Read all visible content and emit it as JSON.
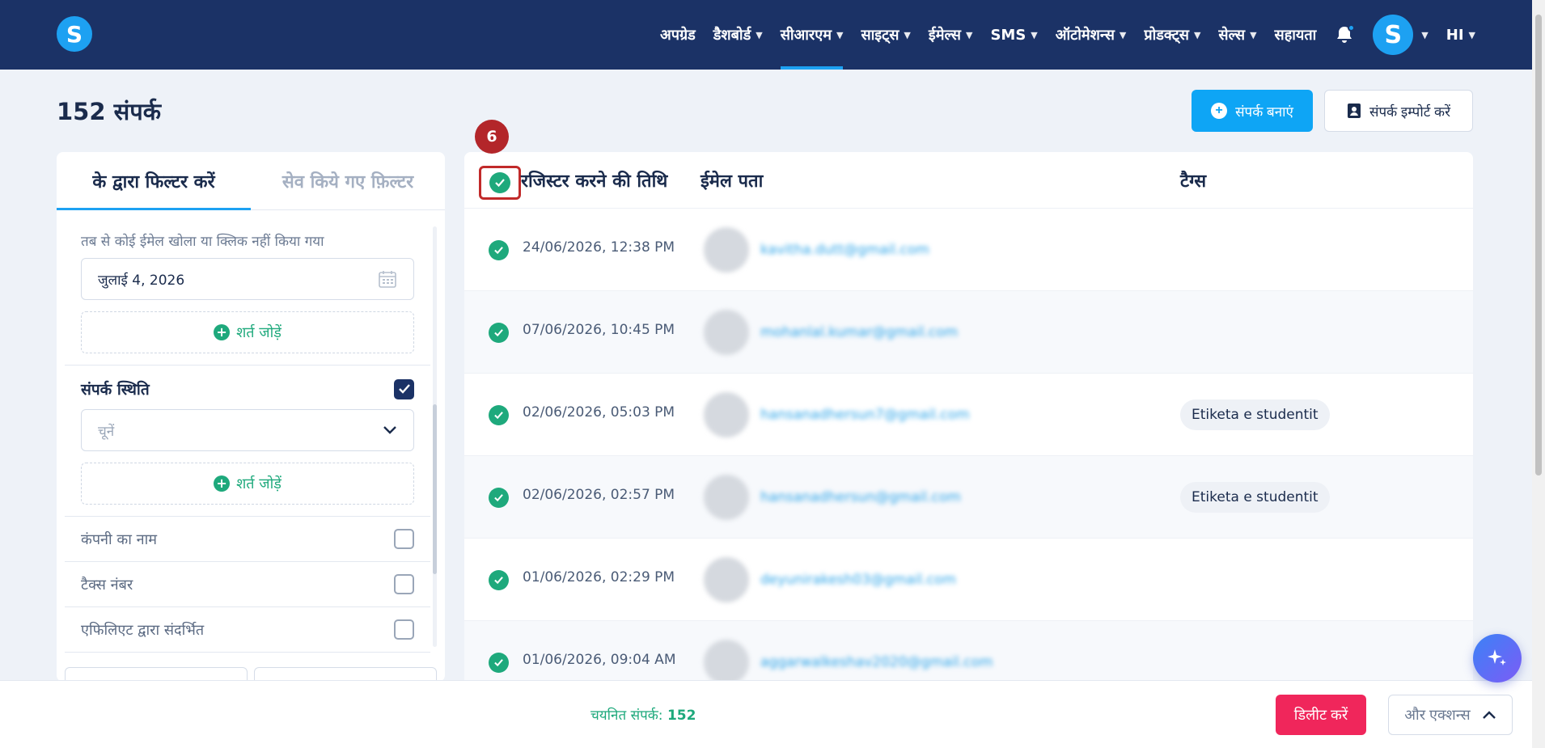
{
  "nav": {
    "items": [
      {
        "label": "अपग्रेड",
        "chevron": false
      },
      {
        "label": "डैशबोर्ड",
        "chevron": true
      },
      {
        "label": "सीआरएम",
        "chevron": true,
        "active": true
      },
      {
        "label": "साइट्स",
        "chevron": true
      },
      {
        "label": "ईमेल्स",
        "chevron": true
      },
      {
        "label": "SMS",
        "chevron": true
      },
      {
        "label": "ऑटोमेशन्स",
        "chevron": true
      },
      {
        "label": "प्रोडक्ट्स",
        "chevron": true
      },
      {
        "label": "सेल्स",
        "chevron": true
      },
      {
        "label": "सहायता",
        "chevron": false
      }
    ],
    "avatar_letter": "S",
    "language": "HI"
  },
  "logo_letter": "S",
  "page": {
    "title": "152 संपर्क",
    "create_button": "संपर्क बनाएं",
    "import_button": "संपर्क इम्पोर्ट करें"
  },
  "filters": {
    "tab_filter_by": "के द्वारा फिल्टर करें",
    "tab_saved": "सेव किये गए फ़िल्टर",
    "hint": "तब से कोई ईमेल खोला या क्लिक नहीं किया गया",
    "date_value": "जुलाई 4, 2026",
    "add_condition": "शर्त जोड़ें",
    "contact_status_label": "संपर्क स्थिति",
    "select_placeholder": "चूनें",
    "checkbox_rows": [
      "कंपनी का नाम",
      "टैक्स नंबर",
      "एफिलिएट द्वारा संदर्भित"
    ]
  },
  "table": {
    "col_date": "रजिस्टर करने की तिथि",
    "col_email": "ईमेल पता",
    "col_tags": "टैग्स",
    "rows": [
      {
        "date": "24/06/2026, 12:38 PM",
        "email": "kavitha.dutt@gmail.com",
        "tag": ""
      },
      {
        "date": "07/06/2026, 10:45 PM",
        "email": "mohanlal.kumar@gmail.com",
        "tag": ""
      },
      {
        "date": "02/06/2026, 05:03 PM",
        "email": "hansanadhersun7@gmail.com",
        "tag": "Etiketa e studentit"
      },
      {
        "date": "02/06/2026, 02:57 PM",
        "email": "hansanadhersun@gmail.com",
        "tag": "Etiketa e studentit"
      },
      {
        "date": "01/06/2026, 02:29 PM",
        "email": "deyunirakesh03@gmail.com",
        "tag": ""
      },
      {
        "date": "01/06/2026, 09:04 AM",
        "email": "aggarwalkeshav2020@gmail.com",
        "tag": ""
      }
    ]
  },
  "step_badge": "6",
  "footer": {
    "selected_label": "चयनित संपर्क:",
    "selected_count": "152",
    "delete_button": "डिलीट करें",
    "more_actions": "और एक्शन्स"
  },
  "colors": {
    "nav_bg": "#1b3266",
    "accent": "#1da1f2",
    "success": "#1ea97c",
    "danger": "#f0265b",
    "badge": "#b3262a"
  }
}
